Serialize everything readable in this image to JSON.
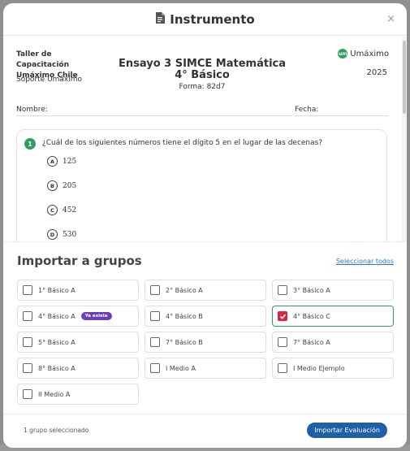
{
  "modal": {
    "title": "Instrumento",
    "title_icon": "document-icon",
    "close_label": "×"
  },
  "document": {
    "org_name": "Taller de Capacitación Umáximo Chile",
    "org_sub": "Soporte Umáximo",
    "title": "Ensayo 3 SIMCE Matemática 4° Básico",
    "form": "Forma: 82d7",
    "brand_mark": "um",
    "brand_name": "Umáximo",
    "year": "2025",
    "name_label": "Nombre:",
    "date_label": "Fecha:"
  },
  "question": {
    "number": "1",
    "text": "¿Cuál de los siguientes números tiene el dígito 5 en el lugar de las decenas?",
    "options": [
      {
        "letter": "A",
        "text": "125"
      },
      {
        "letter": "B",
        "text": "205"
      },
      {
        "letter": "C",
        "text": "452"
      },
      {
        "letter": "D",
        "text": "530"
      }
    ]
  },
  "import_panel": {
    "title": "Importar a grupos",
    "select_all": "Seleccionar todos",
    "groups": [
      {
        "label": "1° Básico A",
        "checked": false,
        "badge": ""
      },
      {
        "label": "2° Básico A",
        "checked": false,
        "badge": ""
      },
      {
        "label": "3° Básico A",
        "checked": false,
        "badge": ""
      },
      {
        "label": "4° Básico A",
        "checked": false,
        "badge": "Ya existe"
      },
      {
        "label": "4° Básico B",
        "checked": false,
        "badge": ""
      },
      {
        "label": "4° Básico C",
        "checked": true,
        "badge": ""
      },
      {
        "label": "5° Básico A",
        "checked": false,
        "badge": ""
      },
      {
        "label": "7° Básico B",
        "checked": false,
        "badge": ""
      },
      {
        "label": "7° Básico A",
        "checked": false,
        "badge": ""
      },
      {
        "label": "8° Básico A",
        "checked": false,
        "badge": ""
      },
      {
        "label": "I Medio A",
        "checked": false,
        "badge": ""
      },
      {
        "label": "I Medio Ejemplo",
        "checked": false,
        "badge": ""
      },
      {
        "label": "II Medio A",
        "checked": false,
        "badge": ""
      }
    ]
  },
  "footer": {
    "status": "1 grupo seleccionado",
    "import_button": "Importar Evaluación"
  },
  "colors": {
    "accent_green": "#2f9e5f",
    "primary_blue": "#1f5fa8",
    "checked_red": "#d7263d",
    "badge_purple": "#6b3fb8"
  }
}
